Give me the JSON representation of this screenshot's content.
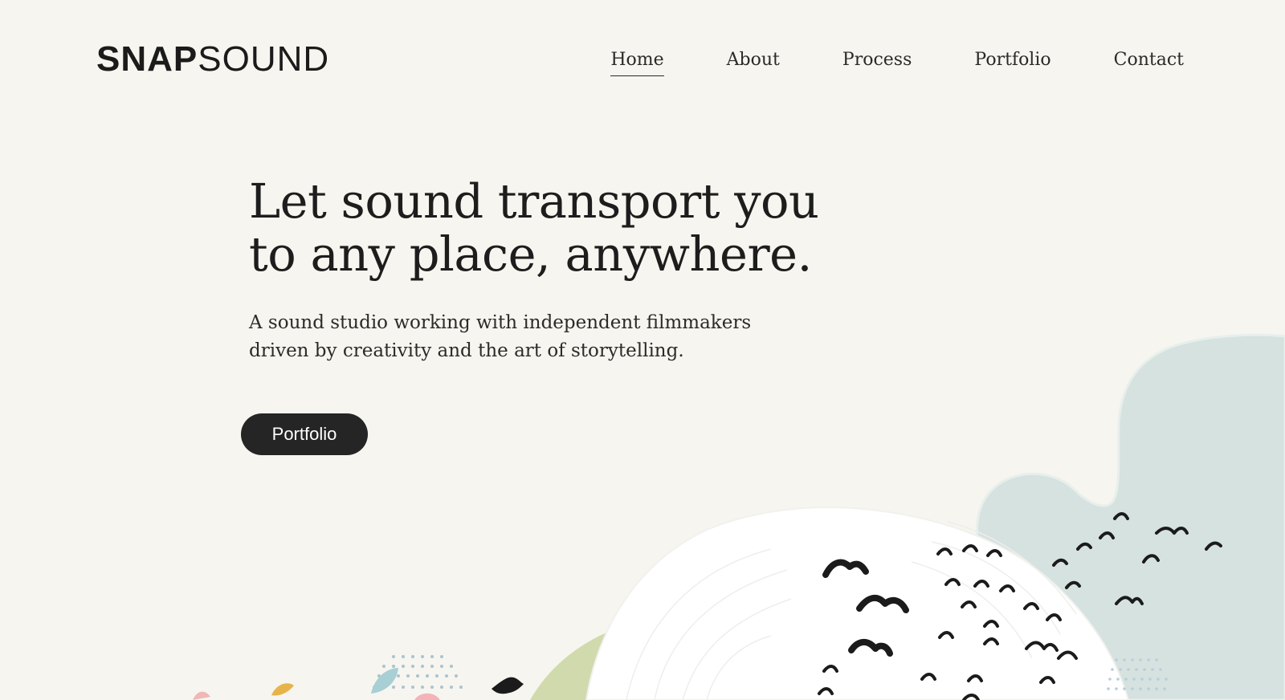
{
  "brand": {
    "bold": "SNAP",
    "light": "SOUND"
  },
  "nav": {
    "items": [
      {
        "label": "Home",
        "active": true
      },
      {
        "label": "About",
        "active": false
      },
      {
        "label": "Process",
        "active": false
      },
      {
        "label": "Portfolio",
        "active": false
      },
      {
        "label": "Contact",
        "active": false
      }
    ]
  },
  "hero": {
    "title_line_1": "Let sound transport you",
    "title_line_2": "to any place, anywhere.",
    "subtitle_line_1": "A sound studio working with independent filmmakers",
    "subtitle_line_2": "driven by creativity and the art of storytelling.",
    "cta_label": "Portfolio"
  },
  "colors": {
    "background": "#f6f5ef",
    "ink": "#1f1f1f",
    "button": "#252525",
    "cloud_blue": "#d5e2df",
    "cloud_white": "#ffffff",
    "leaf_green": "#cdd8a8"
  }
}
